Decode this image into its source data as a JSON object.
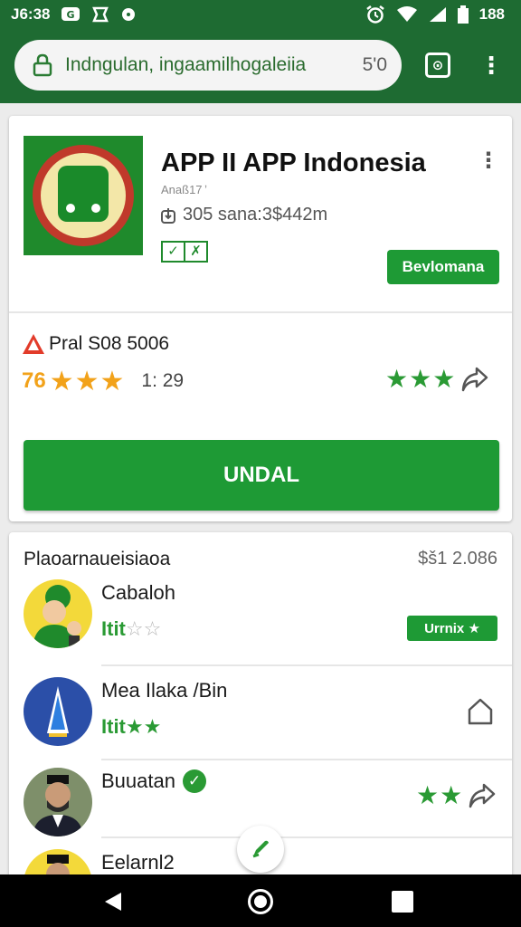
{
  "status_bar": {
    "time": "J6:38",
    "battery": "188",
    "left_icons": [
      "message-icon",
      "screenshot-icon",
      "dot-icon"
    ],
    "right_icons": [
      "alarm-icon",
      "wifi-icon",
      "signal-icon",
      "battery-icon"
    ]
  },
  "browser": {
    "url": "Indngulan, ingaamilhogaleiia",
    "tab_count_text": "5'0",
    "tab_button_label": "⊙"
  },
  "app": {
    "title": "APP II APP Indonesia",
    "developer": "Anaß17 ʼ",
    "size_text": "305 sana:3$442m",
    "badge_left": "✓",
    "badge_right": "✗",
    "secondary_button": "Bevlomana",
    "more_label": "⋮"
  },
  "rating_block": {
    "warning_text": "Pral S08 5006",
    "prefix": "76",
    "stars_filled": 3,
    "stars_text": "★★★",
    "time_text": "1: 29",
    "right_stars_text": "★★★"
  },
  "install_button": "UNDAL",
  "section": {
    "title": "Plaoarnaueisiaoa",
    "meta": "$š1 2.086",
    "items": [
      {
        "name": "Cabaloh",
        "rating_green": "Itit",
        "rating_empty": "☆☆",
        "tag": "Urrnix ★"
      },
      {
        "name": "Mea Ilaka /Bin",
        "rating_green": "Itit★★"
      },
      {
        "name": "Buuatan",
        "verified": "✓",
        "right_stars": "★★"
      },
      {
        "name": "Eelarnl2"
      }
    ]
  },
  "colors": {
    "brand_green": "#1e6b32",
    "button_green": "#1e9a35",
    "star_gold": "#f2a21a",
    "star_green": "#2a9a34"
  }
}
